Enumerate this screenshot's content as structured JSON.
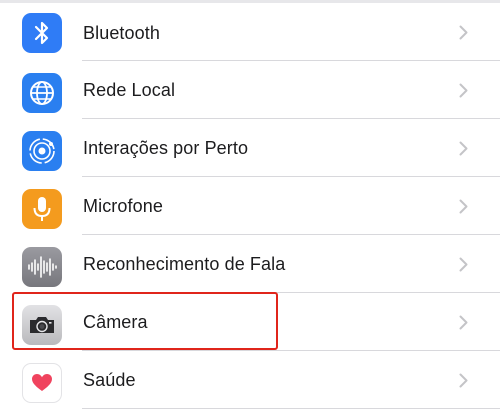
{
  "colors": {
    "bluetooth_icon_bg": "#2f7cf6",
    "local_network_icon_bg": "#2a7ff0",
    "nearby_icon_bg": "#2a7ff0",
    "microphone_icon_bg": "#f49b1e",
    "speech_icon_bg": "#8e8e93",
    "camera_icon_bg": "#cfcfd3",
    "health_icon_bg": "#ffffff",
    "highlight_border": "#e0251b",
    "chevron": "#c4c4c7"
  },
  "settings_list": {
    "items": [
      {
        "label": "Bluetooth",
        "icon": "bluetooth-icon"
      },
      {
        "label": "Rede Local",
        "icon": "globe-network-icon"
      },
      {
        "label": "Interações por Perto",
        "icon": "nearby-interaction-icon"
      },
      {
        "label": "Microfone",
        "icon": "microphone-icon"
      },
      {
        "label": "Reconhecimento de Fala",
        "icon": "waveform-icon"
      },
      {
        "label": "Câmera",
        "icon": "camera-icon",
        "highlighted": true
      },
      {
        "label": "Saúde",
        "icon": "heart-icon"
      }
    ]
  }
}
